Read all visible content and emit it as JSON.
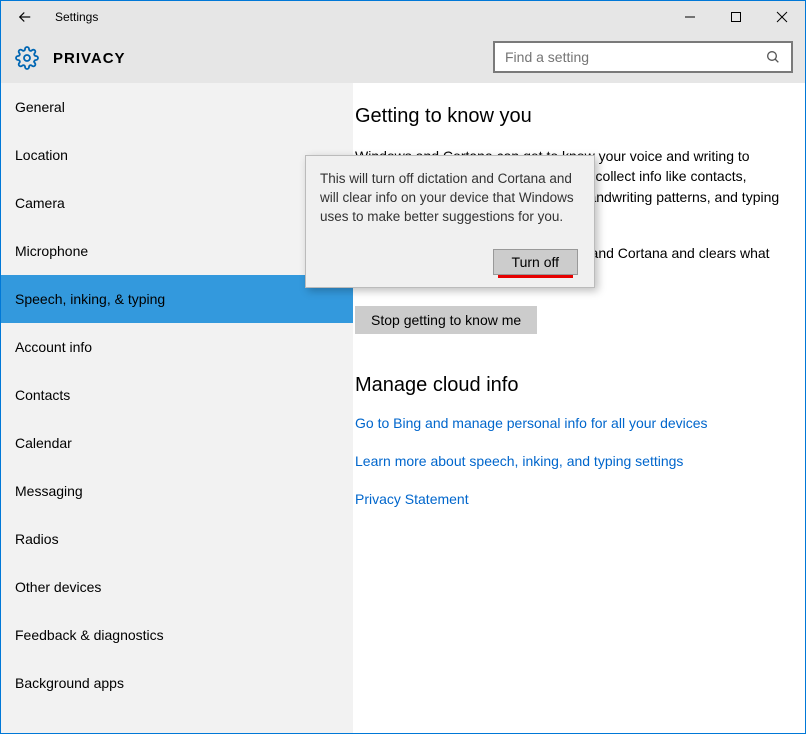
{
  "titlebar": {
    "title": "Settings"
  },
  "header": {
    "title": "PRIVACY"
  },
  "search": {
    "placeholder": "Find a setting"
  },
  "sidebar": {
    "items": [
      {
        "label": "General"
      },
      {
        "label": "Location"
      },
      {
        "label": "Camera"
      },
      {
        "label": "Microphone"
      },
      {
        "label": "Speech, inking, & typing"
      },
      {
        "label": "Account info"
      },
      {
        "label": "Contacts"
      },
      {
        "label": "Calendar"
      },
      {
        "label": "Messaging"
      },
      {
        "label": "Radios"
      },
      {
        "label": "Other devices"
      },
      {
        "label": "Feedback & diagnostics"
      },
      {
        "label": "Background apps"
      }
    ],
    "selected_index": 4
  },
  "main": {
    "section1_title": "Getting to know you",
    "para1": "Windows and Cortana can get to know your voice and writing to make better suggestions for you. We'll collect info like contacts, recent calendar events, speech and handwriting patterns, and typing history.",
    "para2": "Turning this off also turns off dictation and Cortana and clears what this device knows about you.",
    "stop_button": "Stop getting to know me",
    "section2_title": "Manage cloud info",
    "link1": "Go to Bing and manage personal info for all your devices",
    "link2": "Learn more about speech, inking, and typing settings",
    "link3": "Privacy Statement"
  },
  "popup": {
    "text": "This will turn off dictation and Cortana and will clear info on your device that Windows uses to make better suggestions for you.",
    "button": "Turn off"
  }
}
